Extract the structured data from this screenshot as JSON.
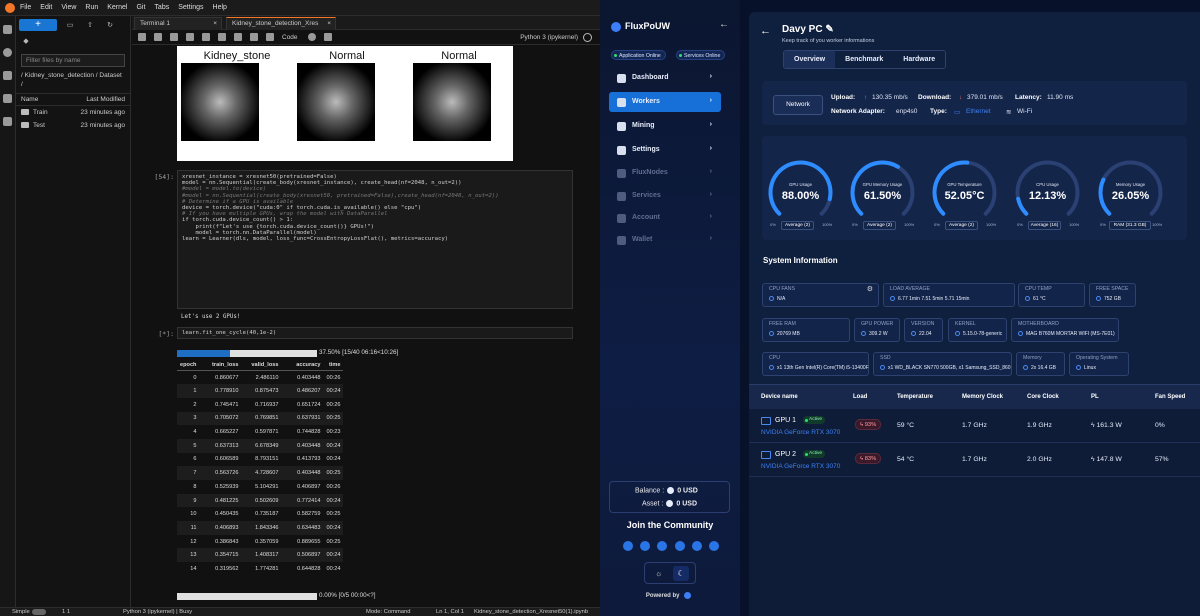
{
  "jupyter": {
    "menu": [
      "File",
      "Edit",
      "View",
      "Run",
      "Kernel",
      "Git",
      "Tabs",
      "Settings",
      "Help"
    ],
    "filter_placeholder": "Filter files by name",
    "breadcrumb": "/ Kidney_stone_detection / Dataset /",
    "col_name": "Name",
    "col_modified": "Last Modified",
    "files": [
      {
        "name": "Train",
        "modified": "23 minutes ago"
      },
      {
        "name": "Test",
        "modified": "23 minutes ago"
      }
    ],
    "tabs": [
      "Terminal 1",
      "Kidney_stone_detection_Xres"
    ],
    "cell_type": "Code",
    "kernel": "Python 3 (ipykernel)",
    "image_titles": [
      "Kidney_stone",
      "Normal",
      "Normal"
    ],
    "cell54_prompt": "[54]:",
    "cell54_lines": [
      "xresnet_instance = xresnet50(pretrained=False)",
      "model = nn.Sequential(create_body(xresnet_instance), create_head(nf=2048, n_out=2))",
      "#model = model.to(device)",
      "#model = nn.Sequential(create_body(xresnet50, pretrained=False),create_head(nf=2048, n_out=2))",
      "",
      "",
      "# Determine if a GPU is available",
      "device = torch.device(\"cuda:0\" if torch.cuda.is_available() else \"cpu\")",
      "",
      "# If you have multiple GPUs, wrap the model with DataParallel",
      "if torch.cuda.device_count() > 1:",
      "    print(f\"Let's use {torch.cuda.device_count()} GPUs!\")",
      "    model = torch.nn.DataParallel(model)",
      "",
      "learn = Learner(dls, model, loss_func=CrossEntropyLossFlat(), metrics=accuracy)"
    ],
    "cell54_output": "Let's use 2 GPUs!",
    "cell_run_prompt": "[*]:",
    "cell_run_code": "learn.fit_one_cycle(40,1e-2)",
    "progress_pct": 37.5,
    "progress_text": "37.50% [15/40 06:16<10:26]",
    "table_headers": [
      "epoch",
      "train_loss",
      "valid_loss",
      "accuracy",
      "time"
    ],
    "table_rows": [
      [
        "0",
        "0.860677",
        "2.486110",
        "0.403448",
        "00:26"
      ],
      [
        "1",
        "0.778910",
        "0.875473",
        "0.486207",
        "00:24"
      ],
      [
        "2",
        "0.745471",
        "0.716937",
        "0.651724",
        "00:26"
      ],
      [
        "3",
        "0.705072",
        "0.769851",
        "0.637931",
        "00:25"
      ],
      [
        "4",
        "0.665227",
        "0.597871",
        "0.744828",
        "00:23"
      ],
      [
        "5",
        "0.637313",
        "6.678349",
        "0.403448",
        "00:24"
      ],
      [
        "6",
        "0.606589",
        "8.793151",
        "0.413793",
        "00:24"
      ],
      [
        "7",
        "0.563726",
        "4.728607",
        "0.403448",
        "00:25"
      ],
      [
        "8",
        "0.525939",
        "5.104291",
        "0.406897",
        "00:26"
      ],
      [
        "9",
        "0.481225",
        "0.502609",
        "0.772414",
        "00:24"
      ],
      [
        "10",
        "0.450435",
        "0.735187",
        "0.582759",
        "00:25"
      ],
      [
        "11",
        "0.406893",
        "1.843346",
        "0.634483",
        "00:24"
      ],
      [
        "12",
        "0.386843",
        "0.357059",
        "0.889655",
        "00:25"
      ],
      [
        "13",
        "0.354715",
        "1.408317",
        "0.506897",
        "00:24"
      ],
      [
        "14",
        "0.319562",
        "1.774281",
        "0.644828",
        "00:24"
      ]
    ],
    "progress2_text": "0.00% [0/5 00:00<?]",
    "status": {
      "mode_label": "Simple",
      "counts": "1   1",
      "kernel_state": "Python 3 (ipykernel) | Busy",
      "mode": "Mode: Command",
      "position": "Ln 1, Col 1",
      "file": "Kidney_stone_detection_Xresnet50(1).ipynb"
    }
  },
  "flux": {
    "brand": "FluxPoUW",
    "pills": [
      "Application Online",
      "Services Online"
    ],
    "nav": [
      {
        "label": "Dashboard",
        "active": false,
        "dim": false
      },
      {
        "label": "Workers",
        "active": true,
        "dim": false
      },
      {
        "label": "Mining",
        "active": false,
        "dim": false
      },
      {
        "label": "Settings",
        "active": false,
        "dim": false
      },
      {
        "label": "FluxNodes",
        "active": false,
        "dim": true
      },
      {
        "label": "Services",
        "active": false,
        "dim": true
      },
      {
        "label": "Account",
        "active": false,
        "dim": true
      },
      {
        "label": "Wallet",
        "active": false,
        "dim": true
      }
    ],
    "balance_label": "Balance :",
    "balance_value": "0 USD",
    "asset_label": "Asset :",
    "asset_value": "0 USD",
    "community": "Join the Community",
    "powered": "Powered by",
    "pc_name": "Davy PC",
    "pc_sub": "Keep track of you worker informations",
    "tabs": [
      "Overview",
      "Benchmark",
      "Hardware"
    ],
    "network": {
      "button": "Network",
      "upload_label": "Upload:",
      "upload": "130.35 mb/s",
      "download_label": "Download:",
      "download": "379.01 mb/s",
      "latency_label": "Latency:",
      "latency": "11.90 ms",
      "adapter_label": "Network Adapter:",
      "adapter": "enp4s0",
      "type_label": "Type:",
      "type_eth": "Ethernet",
      "type_wifi": "Wi-Fi"
    },
    "gauges": [
      {
        "label": "GPU Usage",
        "value": "88.00%",
        "fraction": 0.88,
        "select": "Average (2)"
      },
      {
        "label": "GPU Memory Usage",
        "value": "61.50%",
        "fraction": 0.615,
        "select": "Average (2)"
      },
      {
        "label": "GPU Temperature",
        "value": "52.05°C",
        "fraction": 0.52,
        "select": "Average (2)"
      },
      {
        "label": "CPU Usage",
        "value": "12.13%",
        "fraction": 0.1213,
        "select": "Average (16)"
      },
      {
        "label": "Memory Usage",
        "value": "26.05%",
        "fraction": 0.2605,
        "select": "RAM (31.3 GB)"
      }
    ],
    "gauge_min": "0%",
    "gauge_max": "100%",
    "sys_title": "System Information",
    "sysinfo": [
      {
        "k": "CPU FANS",
        "v": "N/A"
      },
      {
        "k": "LOAD AVERAGE",
        "v": "6.77 1min  7.51 5min  5.71 15min"
      },
      {
        "k": "CPU TEMP",
        "v": "61 °C"
      },
      {
        "k": "FREE SPACE",
        "v": "752 GB"
      },
      {
        "k": "FREE RAM",
        "v": "20769 MB"
      },
      {
        "k": "GPU POWER",
        "v": "309.2 W"
      },
      {
        "k": "VERSION",
        "v": "22.04"
      },
      {
        "k": "KERNEL",
        "v": "5.15.0-78-generic"
      },
      {
        "k": "MOTHERBOARD",
        "v": "MAG B760M MORTAR WIFI (MS-7E01)"
      },
      {
        "k": "CPU",
        "v": "x1 13th Gen Intel(R) Core(TM) i5-13400F"
      },
      {
        "k": "SSD",
        "v": "x1 WD_BLACK SN770 500GB, x1 Samsung_SSD_860"
      },
      {
        "k": "Memory",
        "v": "2x 16.4 GB"
      },
      {
        "k": "Operating System",
        "v": "Linux"
      }
    ],
    "gpu_headers": [
      "Device name",
      "Load",
      "Temperature",
      "Memory Clock",
      "Core Clock",
      "PL",
      "Fan Speed"
    ],
    "gpus": [
      {
        "name": "GPU 1",
        "badge": "Active",
        "model": "NVIDIA GeForce RTX 3070",
        "load": "93%",
        "temp": "59 °C",
        "mem": "1.7 GHz",
        "core": "1.9 GHz",
        "pl": "161.3 W",
        "fan": "0%"
      },
      {
        "name": "GPU 2",
        "badge": "Active",
        "model": "NVIDIA GeForce RTX 3070",
        "load": "83%",
        "temp": "54 °C",
        "mem": "1.7 GHz",
        "core": "2.0 GHz",
        "pl": "147.8 W",
        "fan": "57%"
      }
    ]
  }
}
